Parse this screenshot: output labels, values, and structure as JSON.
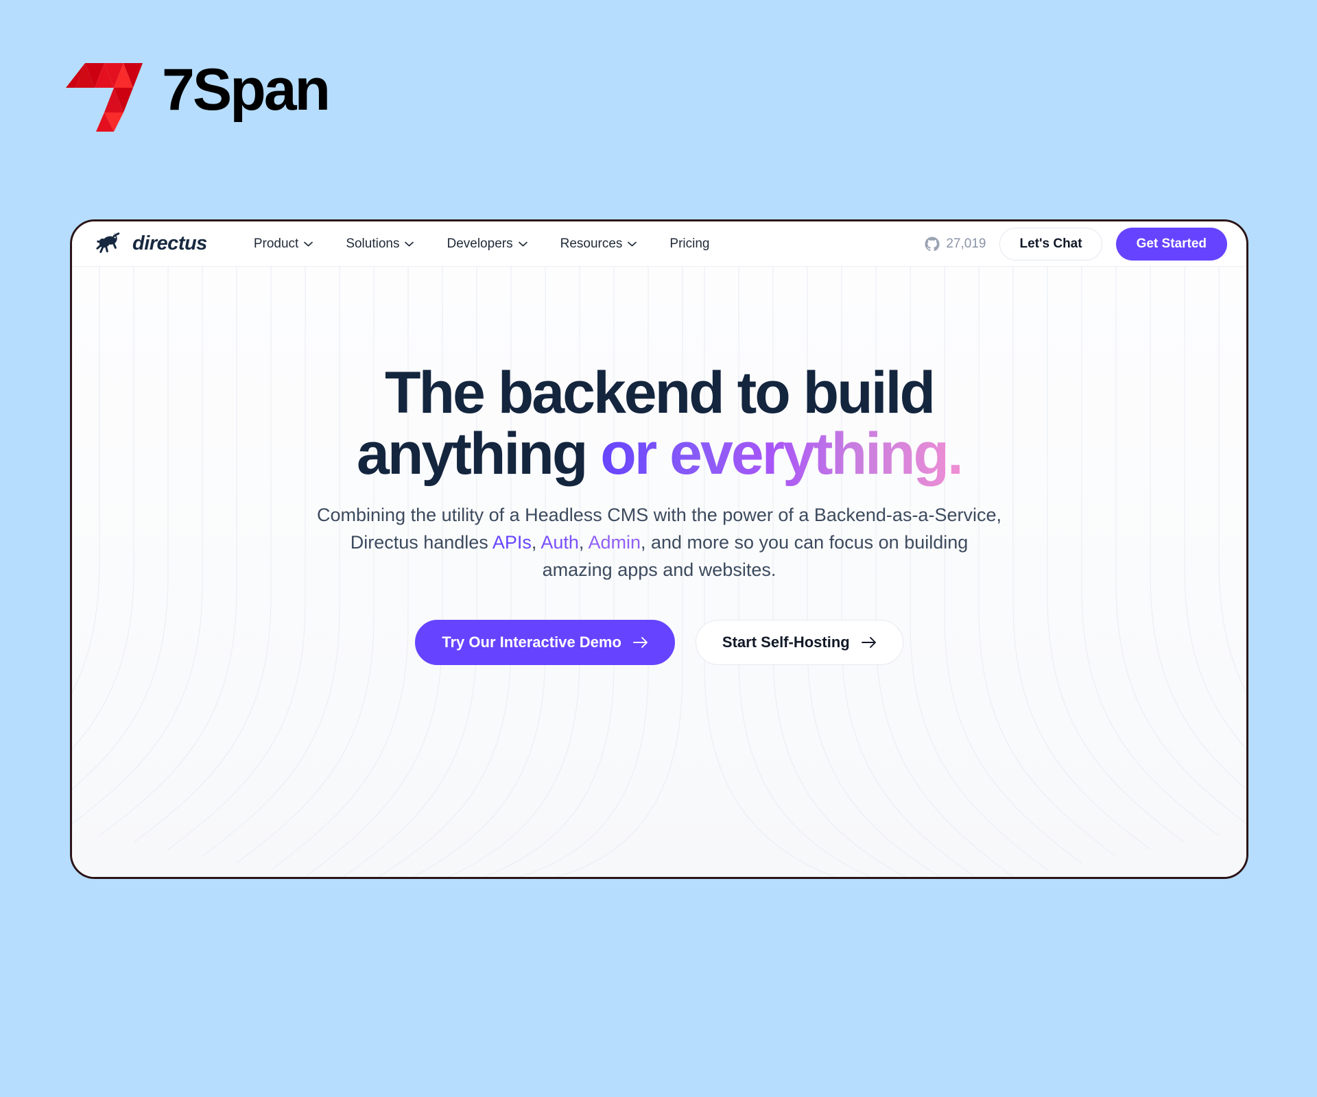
{
  "brand": {
    "name": "7Span",
    "logo_icon": "sevenspan-triangular-7-logo",
    "colors": {
      "red_light": "#f92b2b",
      "red_mid": "#e5101f",
      "red_dark": "#cc0011",
      "red_deep": "#d90d1e"
    }
  },
  "page_background": "#b6ddfd",
  "site": {
    "card_border_color": "#2b1417",
    "navbar": {
      "logo_icon": "directus-rabbit-icon",
      "wordmark": "directus",
      "links": [
        {
          "label": "Product",
          "has_dropdown": true
        },
        {
          "label": "Solutions",
          "has_dropdown": true
        },
        {
          "label": "Developers",
          "has_dropdown": true
        },
        {
          "label": "Resources",
          "has_dropdown": true
        },
        {
          "label": "Pricing",
          "has_dropdown": false
        }
      ],
      "github": {
        "icon": "github-icon",
        "stars": "27,019"
      },
      "chat_button": "Let's Chat",
      "cta_button": "Get Started",
      "cta_color": "#6644ff"
    },
    "hero": {
      "headline_line1": "The backend to build",
      "headline_line2_plain": "anything ",
      "headline_line2_accent": "or everything.",
      "headline_color": "#14253e",
      "accent_gradient_from": "#6644ff",
      "accent_gradient_to": "#ef8fd4",
      "sub_part1": "Combining the utility of a Headless CMS with the power of a Backend-as-a-Service, Directus handles ",
      "sub_kw1": "APIs",
      "sub_sep1": ", ",
      "sub_kw2": "Auth",
      "sub_sep2": ", ",
      "sub_kw3": "Admin",
      "sub_part2": ", and more so you can focus on building amazing apps and websites.",
      "primary_cta": "Try Our Interactive Demo",
      "secondary_cta": "Start Self-Hosting",
      "arrow_icon": "arrow-right-icon"
    }
  }
}
